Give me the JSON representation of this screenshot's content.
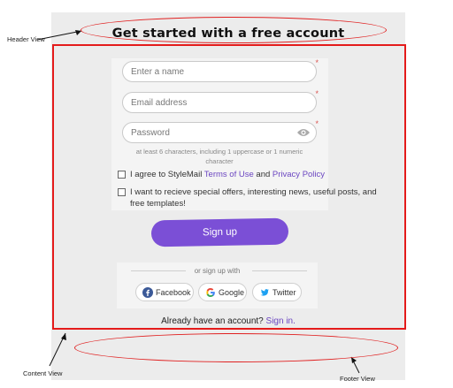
{
  "annotations": {
    "header_view": "Header View",
    "content_view": "Content View",
    "footer_view": "Footer View"
  },
  "header": {
    "title": "Get started with a free account"
  },
  "form": {
    "name_placeholder": "Enter a name",
    "email_placeholder": "Email address",
    "password_placeholder": "Password",
    "required_mark": "*",
    "password_hint": "at least 6 characters, including 1 uppercase or 1 numeric character",
    "terms": {
      "prefix": "I agree to StyleMail ",
      "terms_link": "Terms of Use",
      "and": " and ",
      "privacy_link": "Privacy Policy"
    },
    "offers_label": "I want to recieve special offers, interesting news, useful posts, and free templates!",
    "signup_label": "Sign up"
  },
  "social": {
    "or_text": "or sign up with",
    "facebook": "Facebook",
    "google": "Google",
    "twitter": "Twitter"
  },
  "footer": {
    "prompt": "Already have an account? ",
    "signin_link": "Sign in."
  },
  "colors": {
    "accent": "#7b4fd6",
    "annotation": "#e41b1b",
    "link": "#6b46c1"
  }
}
